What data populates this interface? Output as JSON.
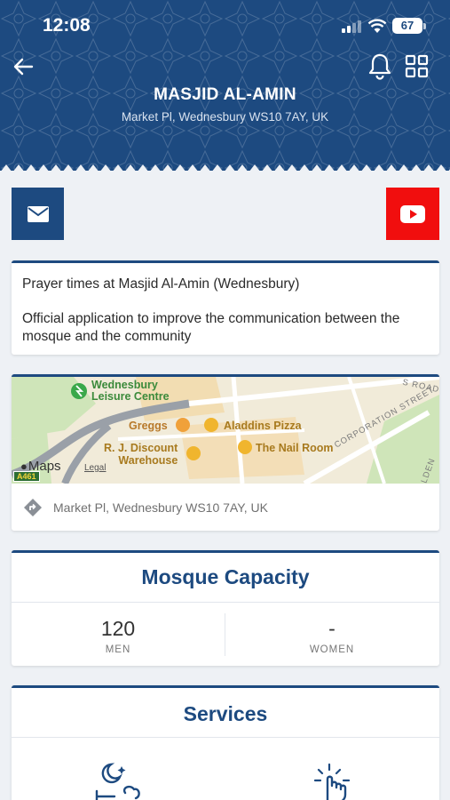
{
  "status_bar": {
    "time": "12:08",
    "battery": "67"
  },
  "header": {
    "title": "MASJID AL-AMIN",
    "address": "Market Pl, Wednesbury WS10 7AY, UK"
  },
  "social": {
    "email": "mail-icon",
    "youtube": "youtube-icon"
  },
  "description": {
    "line1": "Prayer times at Masjid Al-Amin (Wednesbury)",
    "line2": "Official application to improve the communication between the mosque and the community"
  },
  "map": {
    "places": [
      "Wednesbury Leisure Centre",
      "Greggs",
      "Aladdins Pizza",
      "R. J. Discount Warehouse",
      "The Nail Room"
    ],
    "place_line1": "Wednesbury",
    "place_line2": "Leisure Centre",
    "greggs": "Greggs",
    "aladdins": "Aladdins Pizza",
    "rj_line1": "R. J. Discount",
    "rj_line2": "Warehouse",
    "nail_room": "The Nail Room",
    "street1": "CORPORATION STREET",
    "street2": "S ROAD",
    "street3": "LDEN",
    "road_badge": "A461",
    "maps_brand": "Maps",
    "legal": "Legal",
    "directions_address": "Market Pl, Wednesbury WS10 7AY, UK"
  },
  "capacity": {
    "title": "Mosque Capacity",
    "men_value": "120",
    "men_label": "MEN",
    "women_value": "-",
    "women_label": "WOMEN"
  },
  "services": {
    "title": "Services",
    "icons": [
      "ablution-icon",
      "prayer-hand-icon"
    ]
  },
  "colors": {
    "primary": "#1d4a80",
    "youtube": "#f10e0e",
    "background": "#eef1f5"
  }
}
